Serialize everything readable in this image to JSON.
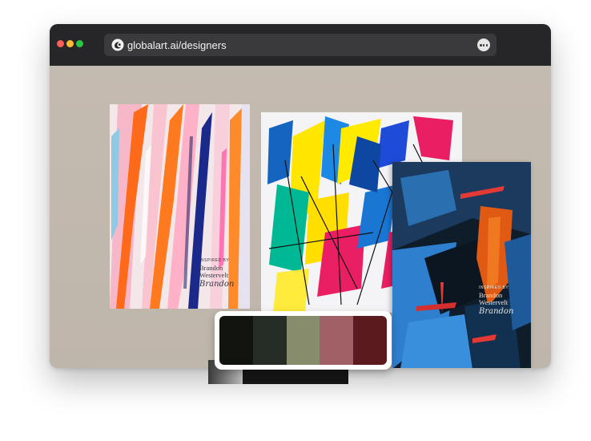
{
  "browser": {
    "url": "globalart.ai/designers",
    "site_icon": "globalart-logo-icon",
    "more_icon": "more-options-icon"
  },
  "artworks": [
    {
      "caption": {
        "inspired_by": "INSPIRED BY",
        "first_name": "Brandon",
        "last_name": "Westervelt",
        "signature": "Brandon"
      }
    },
    {},
    {
      "caption": {
        "inspired_by": "INSPIRED BY",
        "first_name": "Brandon",
        "last_name": "Westervelt",
        "signature": "Brandon"
      }
    }
  ],
  "palette": {
    "colors": [
      "#121410",
      "#262d26",
      "#878c6d",
      "#a16065",
      "#5a1a1e"
    ]
  }
}
